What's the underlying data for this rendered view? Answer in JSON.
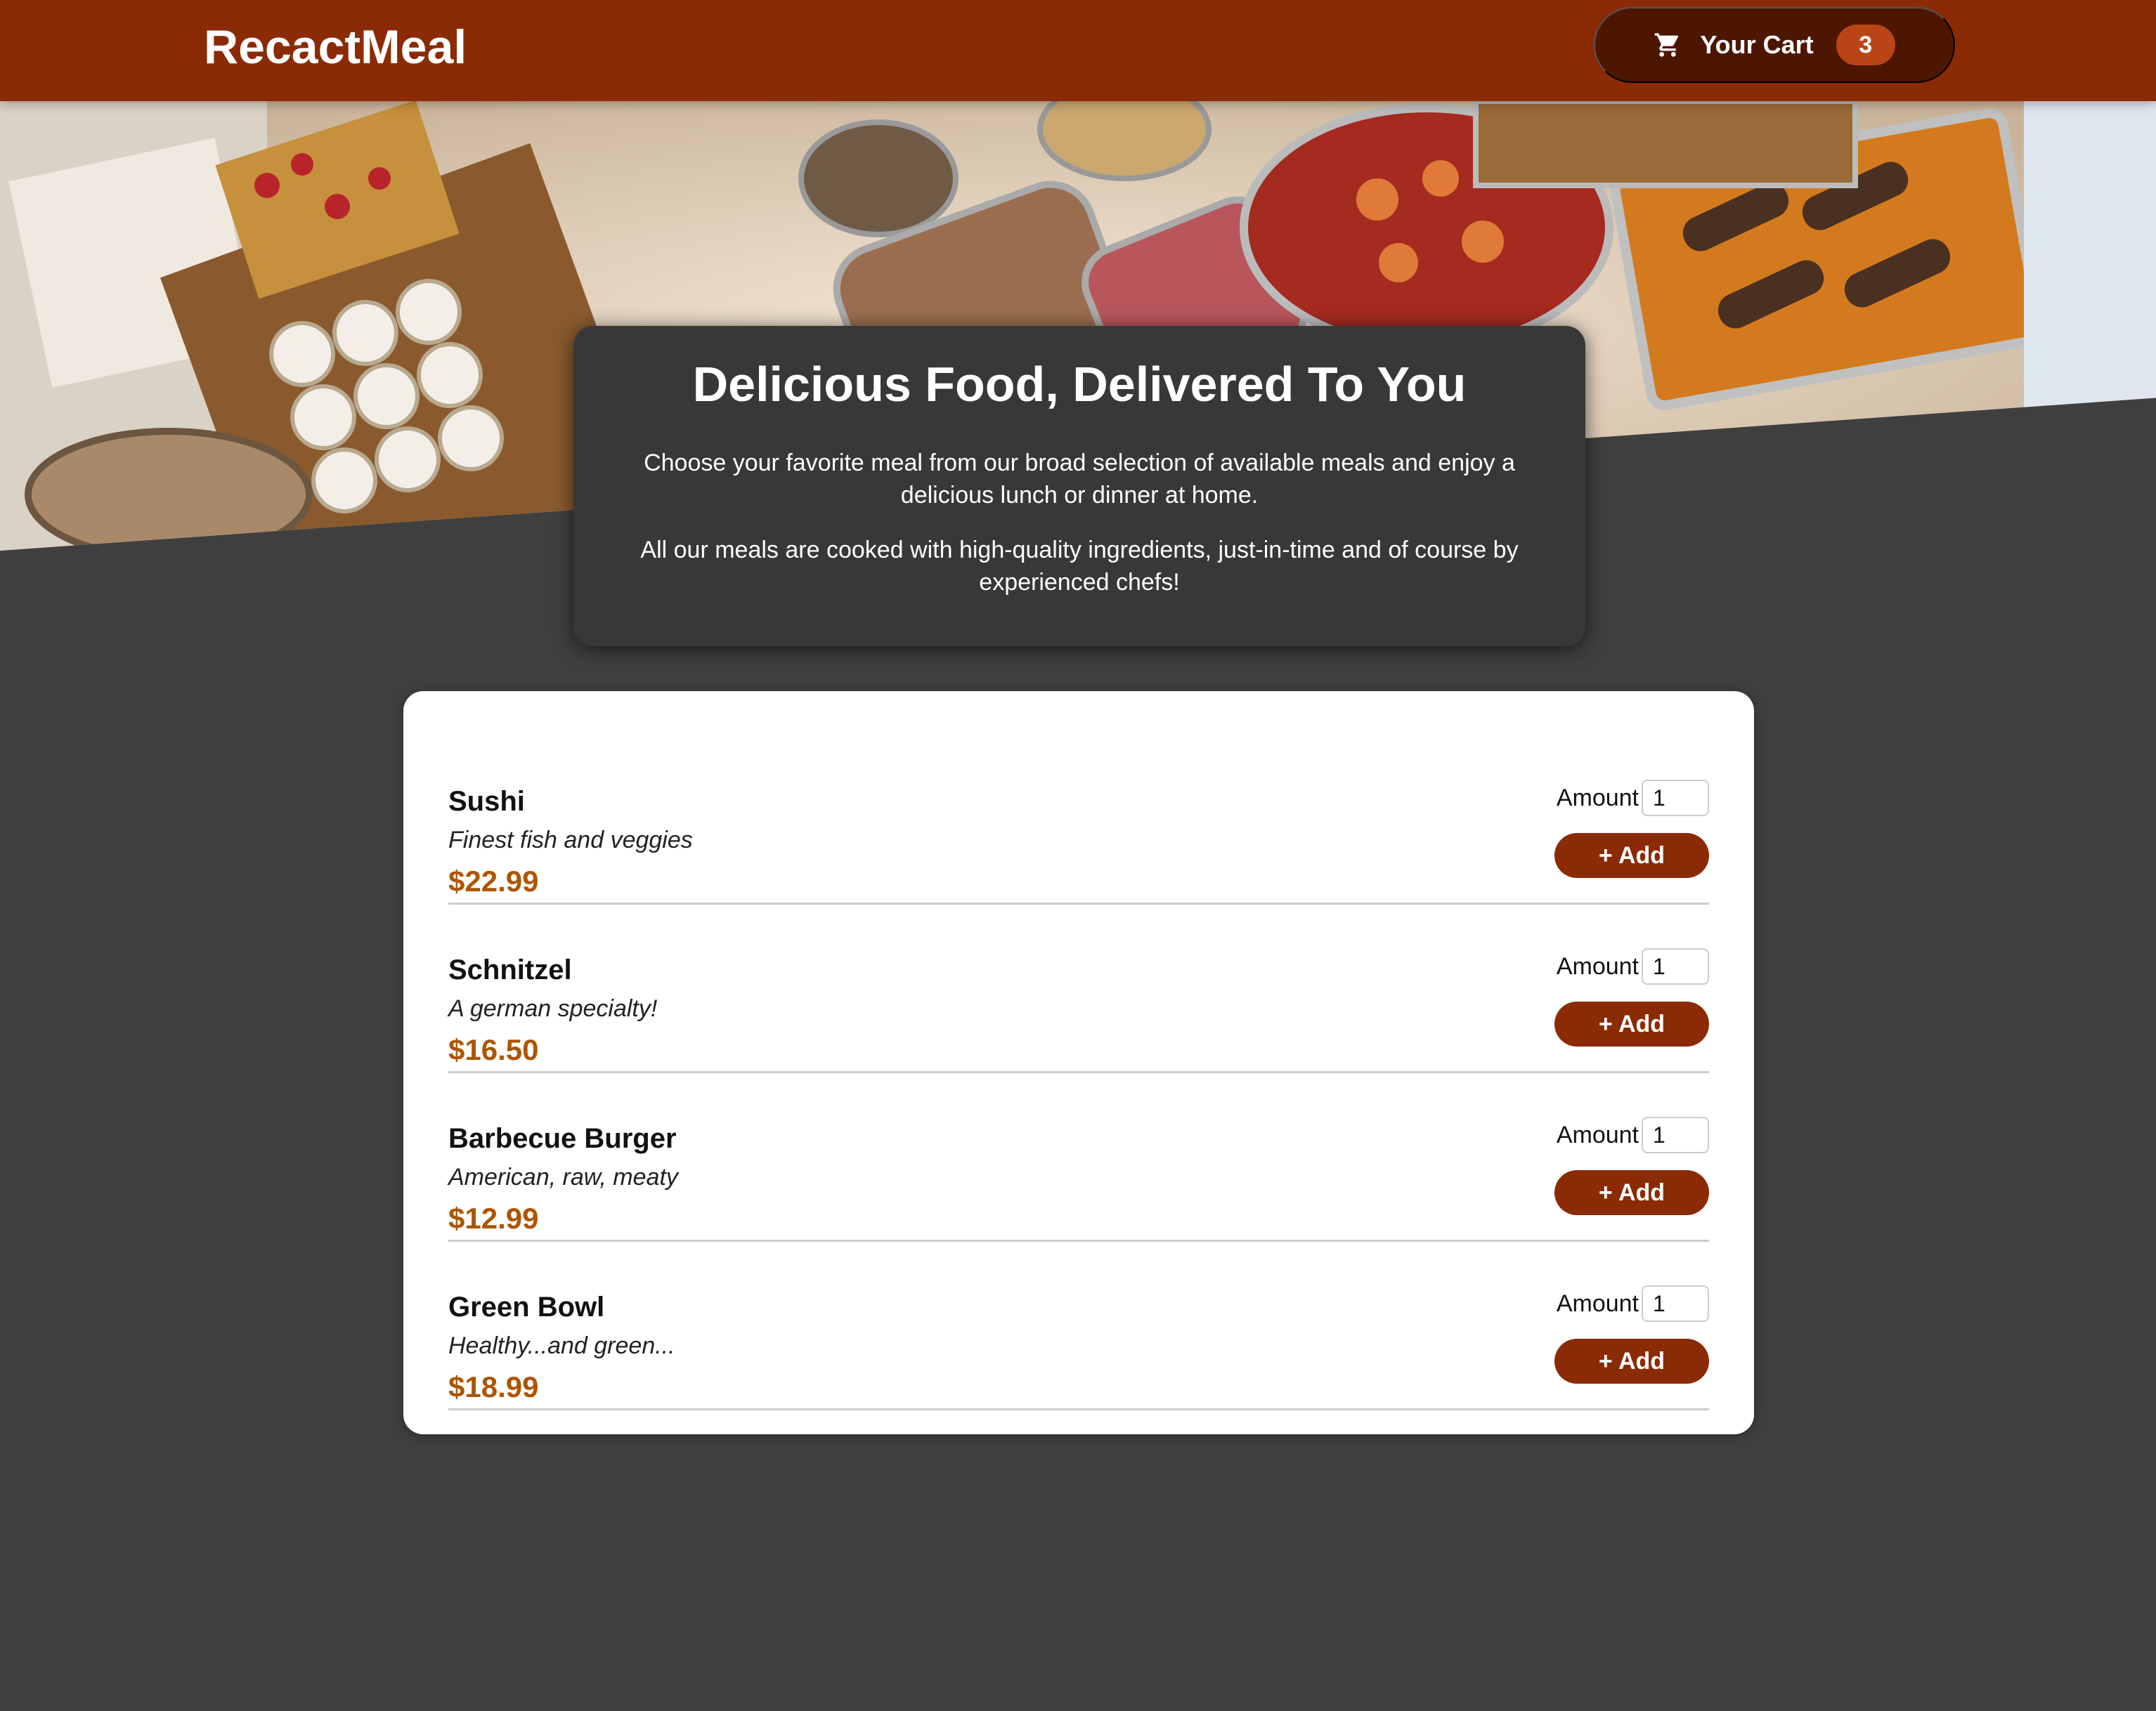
{
  "header": {
    "brand": "RecactMeal",
    "cart": {
      "label": "Your Cart",
      "count": "3",
      "icon": "cart-icon"
    }
  },
  "hero": {
    "image": "buffet table with trays of food"
  },
  "summary": {
    "title": "Delicious Food, Delivered To You",
    "paragraph1": "Choose your favorite meal from our broad selection of available meals and enjoy a delicious lunch or dinner at home.",
    "paragraph2": "All our meals are cooked with high-quality ingredients, just-in-time and of course by experienced chefs!"
  },
  "meals": [
    {
      "name": "Sushi",
      "description": "Finest fish and veggies",
      "price": "$22.99",
      "amount_label": "Amount",
      "amount_value": "1",
      "add_label": "+ Add"
    },
    {
      "name": "Schnitzel",
      "description": "A german specialty!",
      "price": "$16.50",
      "amount_label": "Amount",
      "amount_value": "1",
      "add_label": "+ Add"
    },
    {
      "name": "Barbecue Burger",
      "description": "American, raw, meaty",
      "price": "$12.99",
      "amount_label": "Amount",
      "amount_value": "1",
      "add_label": "+ Add"
    },
    {
      "name": "Green Bowl",
      "description": "Healthy...and green...",
      "price": "$18.99",
      "amount_label": "Amount",
      "amount_value": "1",
      "add_label": "+ Add"
    }
  ],
  "colors": {
    "header": "#8a2b06",
    "cart_button": "#4d1601",
    "cart_badge": "#b94517",
    "background": "#3f3f3f",
    "summary_card": "#383838",
    "price": "#ad5502",
    "add_button": "#8a2b06"
  }
}
